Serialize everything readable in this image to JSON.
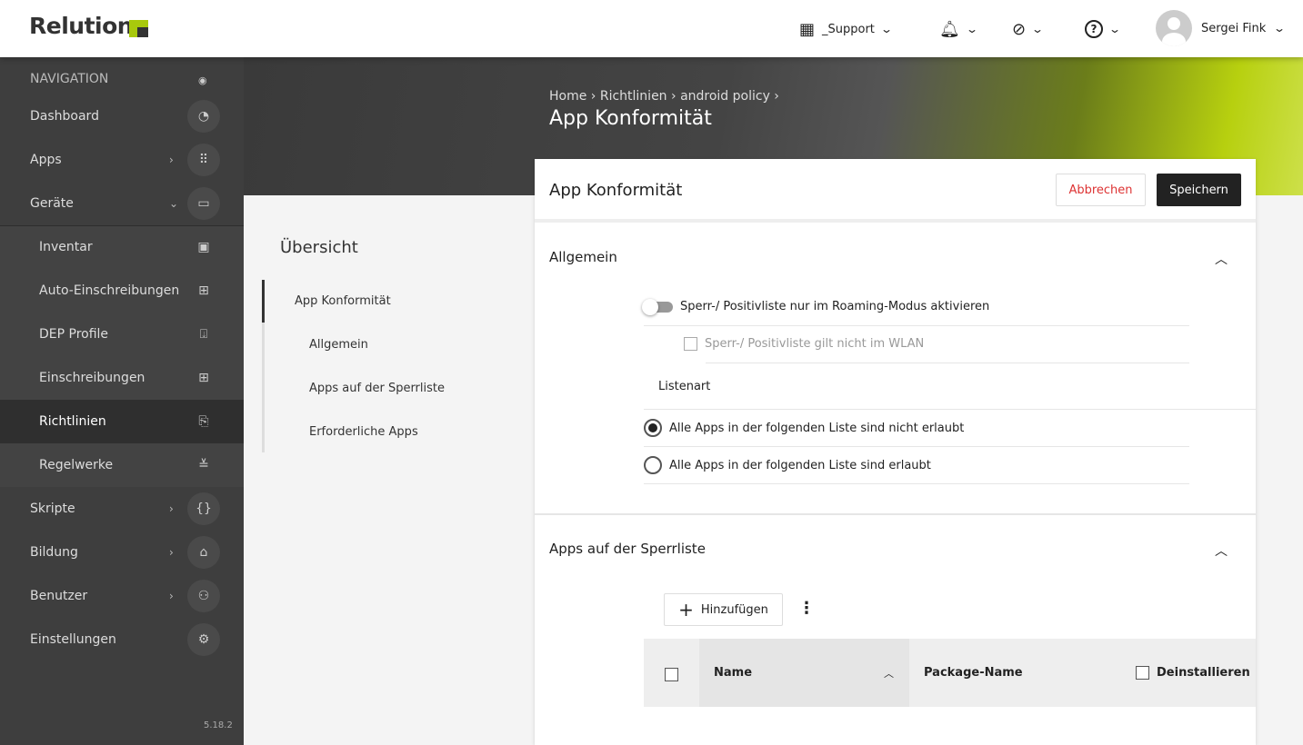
{
  "header": {
    "logo": "Relution",
    "tenant": "_Support",
    "user": "Sergei Fink",
    "accent": "#a8c90c"
  },
  "sidebar": {
    "heading": "NAVIGATION",
    "version": "5.18.2",
    "items": [
      {
        "label": "Dashboard",
        "icon": "gauge-icon"
      },
      {
        "label": "Apps",
        "icon": "grid-icon"
      },
      {
        "label": "Geräte",
        "icon": "devices-icon"
      },
      {
        "label": "Inventar",
        "icon": "inventory-icon"
      },
      {
        "label": "Auto-Einschreibungen",
        "icon": "auto-enroll-icon"
      },
      {
        "label": "DEP Profile",
        "icon": "dep-icon"
      },
      {
        "label": "Einschreibungen",
        "icon": "enroll-icon"
      },
      {
        "label": "Richtlinien",
        "icon": "policy-icon"
      },
      {
        "label": "Regelwerke",
        "icon": "rules-icon"
      },
      {
        "label": "Skripte",
        "icon": "braces-icon"
      },
      {
        "label": "Bildung",
        "icon": "graduation-icon"
      },
      {
        "label": "Benutzer",
        "icon": "user-settings-icon"
      },
      {
        "label": "Einstellungen",
        "icon": "gear-icon"
      }
    ]
  },
  "breadcrumb": [
    "Home",
    "Richtlinien",
    "android policy"
  ],
  "page_title": "App Konformität",
  "overview": {
    "title": "Übersicht",
    "items": [
      "App Konformität",
      "Allgemein",
      "Apps auf der Sperrliste",
      "Erforderliche Apps"
    ]
  },
  "card": {
    "title": "App Konformität",
    "cancel": "Abbrechen",
    "save": "Speichern",
    "general": {
      "title": "Allgemein",
      "toggle_label": "Sperr-/ Positivliste nur im Roaming-Modus aktivieren",
      "toggle_on": false,
      "wlan_label": "Sperr-/ Positivliste gilt nicht im WLAN",
      "wlan_checked": false,
      "list_type_label": "Listenart",
      "options": [
        "Alle Apps in der folgenden Liste sind nicht erlaubt",
        "Alle Apps in der folgenden Liste sind erlaubt"
      ],
      "selected": 0
    },
    "blocklist": {
      "title": "Apps auf der Sperrliste",
      "add": "Hinzufügen",
      "columns": [
        "Name",
        "Package-Name",
        "Deinstallieren"
      ]
    }
  }
}
